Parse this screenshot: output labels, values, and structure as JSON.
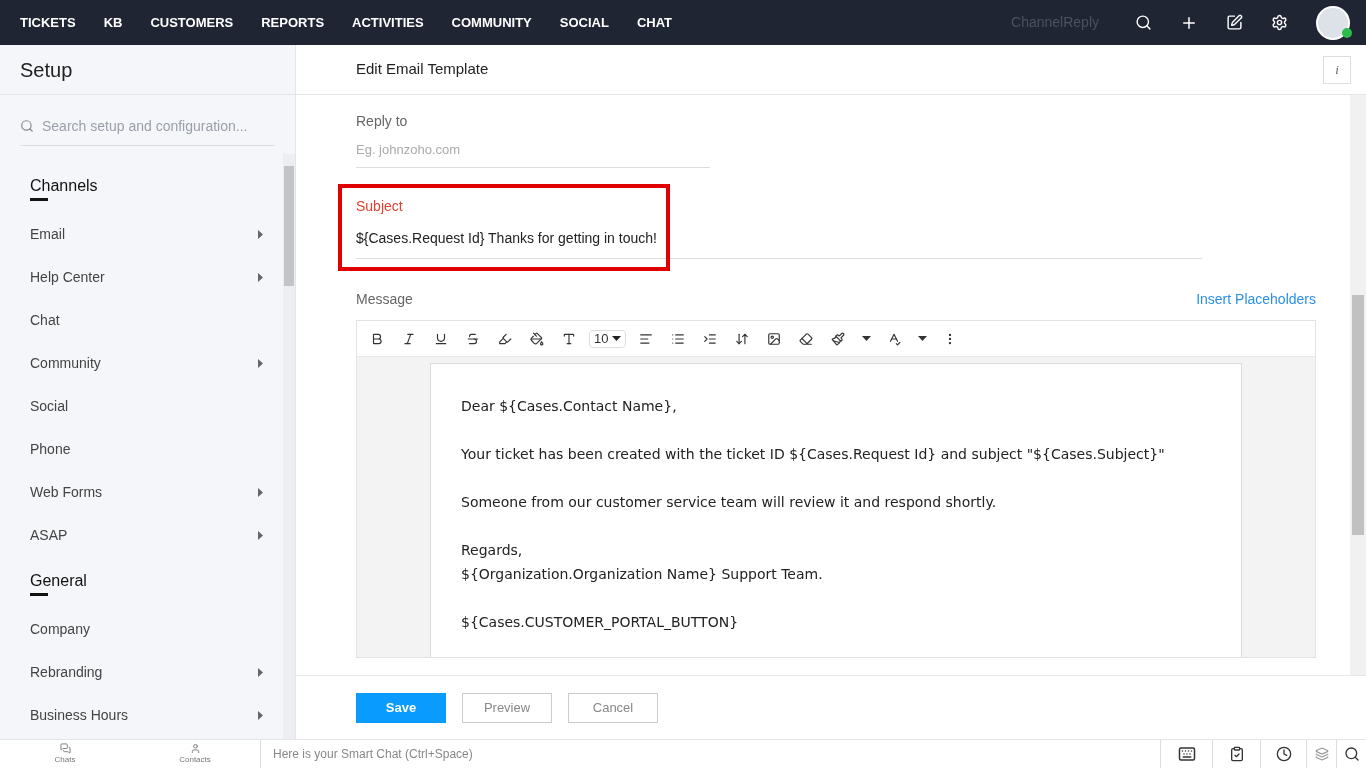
{
  "nav": {
    "items": [
      "TICKETS",
      "KB",
      "CUSTOMERS",
      "REPORTS",
      "ACTIVITIES",
      "COMMUNITY",
      "SOCIAL",
      "CHAT"
    ],
    "brand": "ChannelReply",
    "user_online": true
  },
  "sidebar": {
    "title": "Setup",
    "search": {
      "placeholder": "Search setup and configuration..."
    },
    "sections": [
      {
        "title": "Channels",
        "items": [
          {
            "label": "Email",
            "expandable": true
          },
          {
            "label": "Help Center",
            "expandable": true
          },
          {
            "label": "Chat",
            "expandable": false
          },
          {
            "label": "Community",
            "expandable": true
          },
          {
            "label": "Social",
            "expandable": false
          },
          {
            "label": "Phone",
            "expandable": false
          },
          {
            "label": "Web Forms",
            "expandable": true
          },
          {
            "label": "ASAP",
            "expandable": true
          }
        ]
      },
      {
        "title": "General",
        "items": [
          {
            "label": "Company",
            "expandable": false
          },
          {
            "label": "Rebranding",
            "expandable": true
          },
          {
            "label": "Business Hours",
            "expandable": true
          }
        ]
      }
    ]
  },
  "page": {
    "title": "Edit Email Template",
    "info_icon": "i",
    "reply_to": {
      "label": "Reply to",
      "placeholder": "Eg. johnzoho.com"
    },
    "subject": {
      "label": "Subject",
      "value": "${Cases.Request Id} Thanks for getting in touch!",
      "highlighted": true
    },
    "message": {
      "label": "Message",
      "insert_link": "Insert Placeholders",
      "font_size": "10",
      "paragraphs": [
        [
          "Dear ${Cases.Contact Name},"
        ],
        [
          "Your ticket has been created with the ticket ID ${Cases.Request Id} and subject \"${Cases.Subject}\""
        ],
        [
          "Someone from our customer service team will review it and respond shortly."
        ],
        [
          "Regards,",
          "${Organization.Organization Name} Support Team."
        ],
        [
          "${Cases.CUSTOMER_PORTAL_BUTTON}"
        ]
      ]
    },
    "buttons": [
      {
        "label": "Save",
        "kind": "primary"
      },
      {
        "label": "Preview",
        "kind": "secondary"
      },
      {
        "label": "Cancel",
        "kind": "secondary"
      }
    ]
  },
  "bottom_bar": {
    "tabs": [
      "Chats",
      "Contacts"
    ],
    "smart_chat": {
      "placeholder": "Here is your Smart Chat (Ctrl+Space)"
    }
  }
}
